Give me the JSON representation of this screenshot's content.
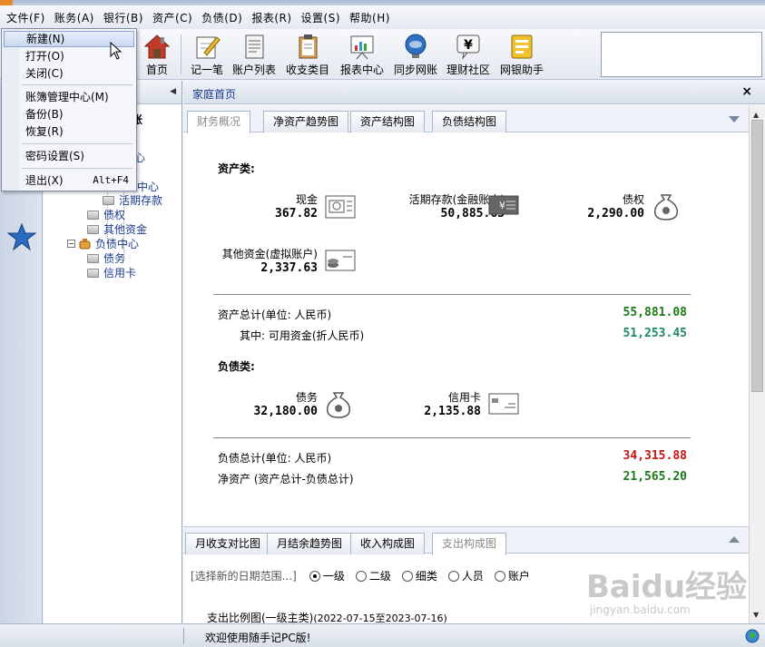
{
  "menubar": [
    "文件(F)",
    "账务(A)",
    "银行(B)",
    "资产(C)",
    "负债(D)",
    "报表(R)",
    "设置(S)",
    "帮助(H)"
  ],
  "toolbar": {
    "items": [
      "首页",
      "记一笔",
      "账户列表",
      "收支类目",
      "报表中心",
      "同步网账",
      "理财社区",
      "网银助手"
    ]
  },
  "file_menu": {
    "items": [
      {
        "label": "新建(N)",
        "accel": ""
      },
      {
        "label": "打开(O)",
        "accel": ""
      },
      {
        "label": "关闭(C)",
        "accel": ""
      },
      {
        "label": "账簿管理中心(M)",
        "accel": ""
      },
      {
        "label": "备份(B)",
        "accel": ""
      },
      {
        "label": "恢复(R)",
        "accel": ""
      },
      {
        "label": "密码设置(S)",
        "accel": ""
      },
      {
        "label": "退出(X)",
        "accel": "Alt+F4"
      }
    ]
  },
  "tree": {
    "partial_labels": [
      "账",
      "心",
      "中心"
    ],
    "items": [
      "活期存款",
      "债权",
      "其他资金",
      "负债中心",
      "债务",
      "信用卡"
    ]
  },
  "main": {
    "title": "家庭首页",
    "close": "×",
    "tabs": [
      "财务概况",
      "净资产趋势图",
      "资产结构图",
      "负债结构图"
    ],
    "assets": {
      "heading": "资产类:",
      "items": [
        {
          "label": "现金",
          "value": "367.82"
        },
        {
          "label": "活期存款(金融账户)",
          "value": "50,885.63"
        },
        {
          "label": "债权",
          "value": "2,290.00"
        },
        {
          "label": "其他资金(虚拟账户)",
          "value": "2,337.63"
        }
      ],
      "total_label": "资产总计(单位: 人民币)",
      "total_value": "55,881.08",
      "avail_label": "其中: 可用资金(折人民币)",
      "avail_value": "51,253.45"
    },
    "liabilities": {
      "heading": "负债类:",
      "items": [
        {
          "label": "债务",
          "value": "32,180.00"
        },
        {
          "label": "信用卡",
          "value": "2,135.88"
        }
      ],
      "total_label": "负债总计(单位: 人民币)",
      "total_value": "34,315.88",
      "net_label": "净资产 (资产总计-负债总计)",
      "net_value": "21,565.20"
    },
    "lower_tabs": [
      "月收支对比图",
      "月结余趋势图",
      "收入构成图",
      "支出构成图"
    ],
    "date_range": "[选择新的日期范围...]",
    "radios": [
      "一级",
      "二级",
      "细类",
      "人员",
      "账户"
    ],
    "chart_caption": "支出比例图(一级主类)",
    "chart_period": "(2022-07-15至2023-07-16)"
  },
  "status": {
    "message": "欢迎使用随手记PC版!"
  },
  "watermark": {
    "brand": "Baidu经验",
    "url": "jingyan.baidu.com"
  },
  "colors": {
    "positive": "#1a7a1a",
    "avail": "#1a8a6a",
    "negative": "#cc1111"
  }
}
